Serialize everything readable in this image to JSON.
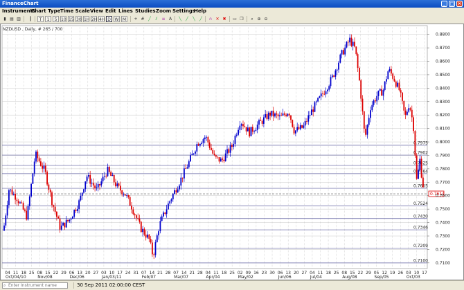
{
  "window": {
    "title": "FinanceChart"
  },
  "menu": [
    "Instruments",
    "Chart Type",
    "Time Scale",
    "View",
    "Edit",
    "Lines",
    "Studies",
    "Zoom",
    "Settings",
    "Help"
  ],
  "toolbar": {
    "timescale": [
      "T",
      "1",
      "5",
      "10",
      "15",
      "30",
      "1H",
      "2H",
      "4H",
      "D",
      "W",
      "M"
    ],
    "selected": "D"
  },
  "chart": {
    "symbol_label": "NZDUSD , Daily, # 265 / 700",
    "current_price": "0.7614",
    "hlines": [
      {
        "label": "0.7975",
        "value": 0.7975
      },
      {
        "label": "0.7902",
        "value": 0.7902
      },
      {
        "label": "0.7825",
        "value": 0.7825
      },
      {
        "label": "0.7764",
        "value": 0.7764
      },
      {
        "label": "0.7655",
        "value": 0.7655
      },
      {
        "label": "0.7524",
        "value": 0.7524
      },
      {
        "label": "0.7430",
        "value": 0.743
      },
      {
        "label": "0.7346",
        "value": 0.7346
      },
      {
        "label": "0.7209",
        "value": 0.7209
      },
      {
        "label": "0.7100",
        "value": 0.71
      }
    ],
    "y_ticks": [
      "0.8800",
      "0.8700",
      "0.8600",
      "0.8500",
      "0.8400",
      "0.8300",
      "0.8200",
      "0.8100",
      "0.8000",
      "0.7900",
      "0.7800",
      "0.7700",
      "0.7600",
      "0.7500",
      "0.7400",
      "0.7300",
      "0.7200",
      "0.7100"
    ],
    "x_days": [
      "04",
      "11",
      "18",
      "25",
      "08",
      "15",
      "22",
      "29",
      "06",
      "13",
      "20",
      "27",
      "03",
      "10",
      "17",
      "24",
      "31",
      "07",
      "14",
      "21",
      "28",
      "07",
      "14",
      "21",
      "28",
      "04",
      "11",
      "18",
      "25",
      "02",
      "09",
      "16",
      "23",
      "30",
      "06",
      "13",
      "20",
      "27",
      "04",
      "11",
      "18",
      "25",
      "08",
      "15",
      "22",
      "29",
      "05",
      "12",
      "19",
      "26",
      "03",
      "10",
      "17"
    ],
    "x_months": [
      "Oct/04/10",
      "Nov/08",
      "Dec/06",
      "Jan/03/11",
      "Feb/07",
      "Mar/07",
      "Apr/04",
      "May/02",
      "Jun/06",
      "Jul/04",
      "Aug/08",
      "Sep/05",
      "Oct/03"
    ]
  },
  "status": {
    "search_placeholder": "Enter Instrument name",
    "datetime": "30 Sep 2011 02:00:00 CEST"
  },
  "colors": {
    "up": "#0000cc",
    "down": "#dd0000",
    "grid": "#c8c8c8",
    "hline": "#6060a0",
    "title": "#0a4cc2"
  }
}
